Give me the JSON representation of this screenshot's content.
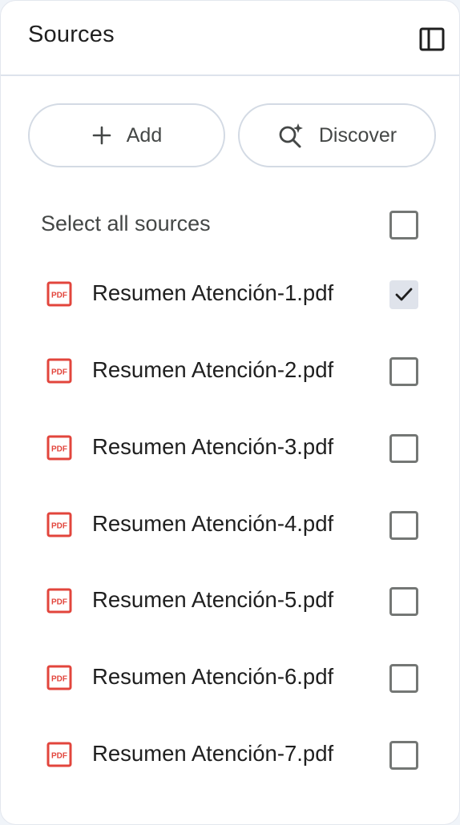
{
  "header": {
    "title": "Sources",
    "toggle_icon": "side-panel-icon"
  },
  "actions": {
    "add_label": "Add",
    "add_icon": "plus-icon",
    "discover_label": "Discover",
    "discover_icon": "sparkle-search-icon"
  },
  "select_all": {
    "label": "Select all sources",
    "checked": false
  },
  "sources": [
    {
      "name": "Resumen Atención-1.pdf",
      "icon": "pdf-icon",
      "checked": true
    },
    {
      "name": "Resumen Atención-2.pdf",
      "icon": "pdf-icon",
      "checked": false
    },
    {
      "name": "Resumen Atención-3.pdf",
      "icon": "pdf-icon",
      "checked": false
    },
    {
      "name": "Resumen Atención-4.pdf",
      "icon": "pdf-icon",
      "checked": false
    },
    {
      "name": "Resumen Atención-5.pdf",
      "icon": "pdf-icon",
      "checked": false
    },
    {
      "name": "Resumen Atención-6.pdf",
      "icon": "pdf-icon",
      "checked": false
    },
    {
      "name": "Resumen Atención-7.pdf",
      "icon": "pdf-icon",
      "checked": false
    }
  ],
  "colors": {
    "pdf_icon": "#e2453c",
    "text_primary": "#1f1f1f",
    "text_secondary": "#444746",
    "checkbox_border": "#747775",
    "checked_bg": "#dfe3eb"
  }
}
